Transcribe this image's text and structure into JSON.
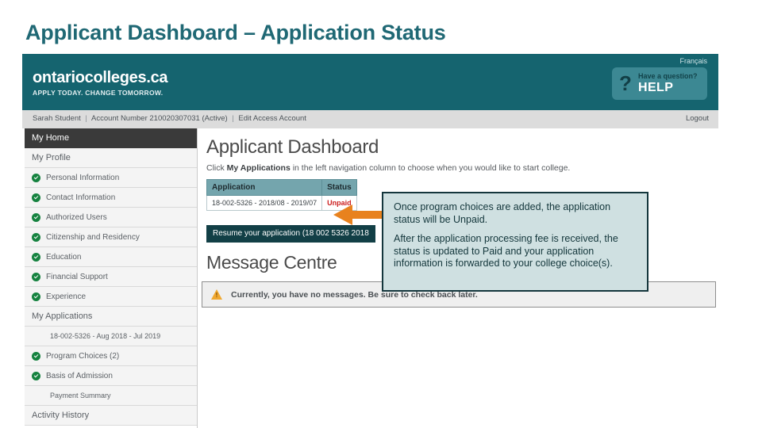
{
  "slide": {
    "title": "Applicant Dashboard – Application Status"
  },
  "site_header": {
    "brand_name": "ontariocolleges.ca",
    "brand_tagline": "APPLY TODAY. CHANGE TOMORROW.",
    "language_link": "Français",
    "help_icon": "question-mark-icon",
    "help_line1": "Have a question?",
    "help_line2": "HELP",
    "brand_color": "#15646f"
  },
  "account_bar": {
    "user_name": "Sarah Student",
    "account_number_label": "Account Number",
    "account_number": "210020307031",
    "account_state": "(Active)",
    "edit_link": "Edit Access Account",
    "logout_link": "Logout"
  },
  "sidebar": {
    "home_label": "My Home",
    "sections": [
      {
        "label": "My Profile",
        "type": "section"
      },
      {
        "label": "Personal Information",
        "type": "item",
        "checked": true
      },
      {
        "label": "Contact Information",
        "type": "item",
        "checked": true
      },
      {
        "label": "Authorized Users",
        "type": "item",
        "checked": true
      },
      {
        "label": "Citizenship and Residency",
        "type": "item",
        "checked": true
      },
      {
        "label": "Education",
        "type": "item",
        "checked": true
      },
      {
        "label": "Financial Support",
        "type": "item",
        "checked": true
      },
      {
        "label": "Experience",
        "type": "item",
        "checked": true
      },
      {
        "label": "My Applications",
        "type": "section"
      },
      {
        "label": "18-002-5326 - Aug 2018 - Jul 2019",
        "type": "subitem",
        "checked": false
      },
      {
        "label": "Program Choices (2)",
        "type": "item",
        "checked": true
      },
      {
        "label": "Basis of Admission",
        "type": "item",
        "checked": true
      },
      {
        "label": "Payment Summary",
        "type": "subitem",
        "checked": false
      },
      {
        "label": "Activity History",
        "type": "section"
      }
    ]
  },
  "main": {
    "page_title": "Applicant Dashboard",
    "subtitle_prefix": "Click ",
    "subtitle_bold": "My Applications",
    "subtitle_suffix": " in the left navigation column to choose when you would like to start college.",
    "table": {
      "headers": [
        "Application",
        "Status"
      ],
      "rows": [
        {
          "application": "18-002-5326 - 2018/08 - 2019/07",
          "status": "Unpaid"
        }
      ],
      "status_color": "#cc2020",
      "header_bg": "#74a5ad"
    },
    "resume_button": "Resume your application (18 002 5326   2018",
    "message_centre_title": "Message Centre",
    "message_icon": "warning-triangle-icon",
    "message_text": "Currently, you have no messages. Be sure to check back later."
  },
  "annotation": {
    "arrow_icon": "left-arrow-icon",
    "arrow_color": "#e8821e",
    "callout_bg": "#cfe0e1",
    "callout_border": "#14363c",
    "paragraph1": "Once program choices are added, the application status will be Unpaid.",
    "paragraph2": "After the application processing fee is received, the status is updated to Paid and your application information is forwarded to your college choice(s)."
  }
}
